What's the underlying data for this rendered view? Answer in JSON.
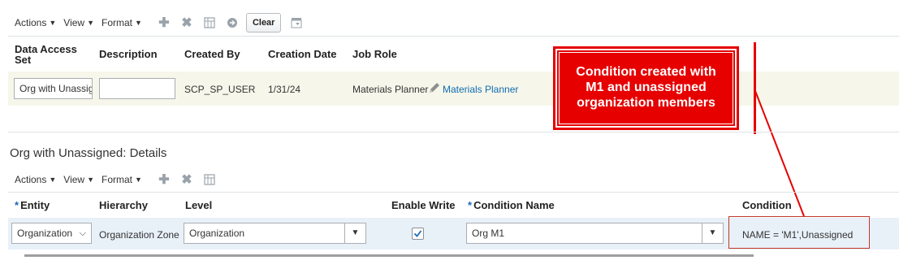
{
  "toolbar1": {
    "actions": "Actions",
    "view": "View",
    "format": "Format",
    "clear": "Clear",
    "icons": [
      "add-icon",
      "delete-icon",
      "freeze-icon",
      "go-icon",
      "detach-icon"
    ]
  },
  "table1": {
    "headers": {
      "data_access_set": "Data Access Set",
      "description": "Description",
      "created_by": "Created By",
      "creation_date": "Creation Date",
      "job_role": "Job Role"
    },
    "row": {
      "data_access_set": "Org with Unassigned",
      "description": "",
      "created_by": "SCP_SP_USER",
      "creation_date": "1/31/24",
      "job_role": "Materials Planner",
      "job_role_link": "Materials Planner"
    }
  },
  "callout": {
    "text": "Condition created with M1 and unassigned organization members",
    "color": "#e60000"
  },
  "details": {
    "title": "Org with Unassigned: Details",
    "toolbar": {
      "actions": "Actions",
      "view": "View",
      "format": "Format"
    },
    "headers": {
      "entity": "Entity",
      "hierarchy": "Hierarchy",
      "level": "Level",
      "enable_write": "Enable Write",
      "condition_name": "Condition Name",
      "condition": "Condition"
    },
    "row": {
      "entity": "Organization",
      "hierarchy": "Organization Zone",
      "level": "Organization",
      "enable_write": true,
      "condition_name": "Org M1",
      "condition": "NAME = 'M1',Unassigned"
    }
  }
}
